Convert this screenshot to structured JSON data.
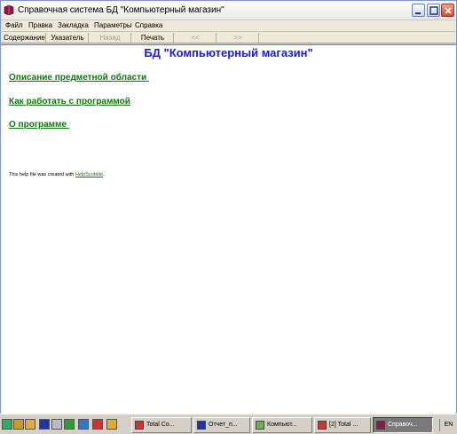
{
  "window": {
    "title": "Справочная система БД \"Компьютерный магазин\""
  },
  "menu": {
    "items": [
      "Файл",
      "Правка",
      "Закладка",
      "Параметры",
      "Справка"
    ]
  },
  "toolbar": {
    "contents": "Содержание",
    "index": "Указатель",
    "back": "Назад",
    "print": "Печать",
    "prev": "<<",
    "next": ">>"
  },
  "content": {
    "heading": "БД \"Компьютерный магазин\"",
    "links": [
      "Описание предметной области ",
      "Как работать с программой",
      "О программе "
    ],
    "footer_prefix": "This help file was created with ",
    "footer_link": "HelpScribble",
    "footer_suffix": "."
  },
  "taskbar": {
    "tasks": [
      "Total Co...",
      "Отчет_п...",
      "Компьют...",
      "[2] Total ...",
      "Справоч..."
    ],
    "language": "EN"
  },
  "colors": {
    "heading": "#1a1af0",
    "link": "#0c7a0c"
  }
}
